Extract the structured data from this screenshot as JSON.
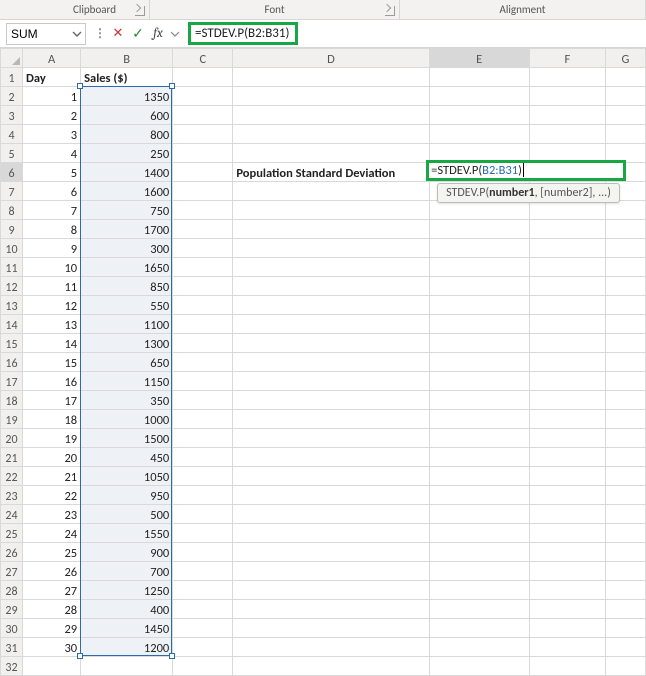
{
  "ribbon": {
    "groups": {
      "clipboard": "Clipboard",
      "font": "Font",
      "alignment": "Alignment"
    }
  },
  "namebox": {
    "value": "SUM"
  },
  "formula_bar": {
    "text": "=STDEV.P(B2:B31)"
  },
  "columns": [
    "A",
    "B",
    "C",
    "D",
    "E",
    "F",
    "G"
  ],
  "headers": {
    "A1": "Day",
    "B1": "Sales ($)"
  },
  "label_D6": "Population Standard Deviation",
  "edit_cell": {
    "prefix": "=STDEV.P(",
    "ref": "B2:B31",
    "suffix": ")",
    "tooltip_fn": "STDEV.P(",
    "tooltip_arg1": "number1",
    "tooltip_rest": ", [number2], ...)"
  },
  "rows": [
    {
      "day": 1,
      "sales": 1350
    },
    {
      "day": 2,
      "sales": 600
    },
    {
      "day": 3,
      "sales": 800
    },
    {
      "day": 4,
      "sales": 250
    },
    {
      "day": 5,
      "sales": 1400
    },
    {
      "day": 6,
      "sales": 1600
    },
    {
      "day": 7,
      "sales": 750
    },
    {
      "day": 8,
      "sales": 1700
    },
    {
      "day": 9,
      "sales": 300
    },
    {
      "day": 10,
      "sales": 1650
    },
    {
      "day": 11,
      "sales": 850
    },
    {
      "day": 12,
      "sales": 550
    },
    {
      "day": 13,
      "sales": 1100
    },
    {
      "day": 14,
      "sales": 1300
    },
    {
      "day": 15,
      "sales": 650
    },
    {
      "day": 16,
      "sales": 1150
    },
    {
      "day": 17,
      "sales": 350
    },
    {
      "day": 18,
      "sales": 1000
    },
    {
      "day": 19,
      "sales": 1500
    },
    {
      "day": 20,
      "sales": 450
    },
    {
      "day": 21,
      "sales": 1050
    },
    {
      "day": 22,
      "sales": 950
    },
    {
      "day": 23,
      "sales": 500
    },
    {
      "day": 24,
      "sales": 1550
    },
    {
      "day": 25,
      "sales": 900
    },
    {
      "day": 26,
      "sales": 700
    },
    {
      "day": 27,
      "sales": 1250
    },
    {
      "day": 28,
      "sales": 400
    },
    {
      "day": 29,
      "sales": 1450
    },
    {
      "day": 30,
      "sales": 1200
    }
  ],
  "visible_row_count": 32,
  "active": {
    "col": "E",
    "row": 6
  }
}
